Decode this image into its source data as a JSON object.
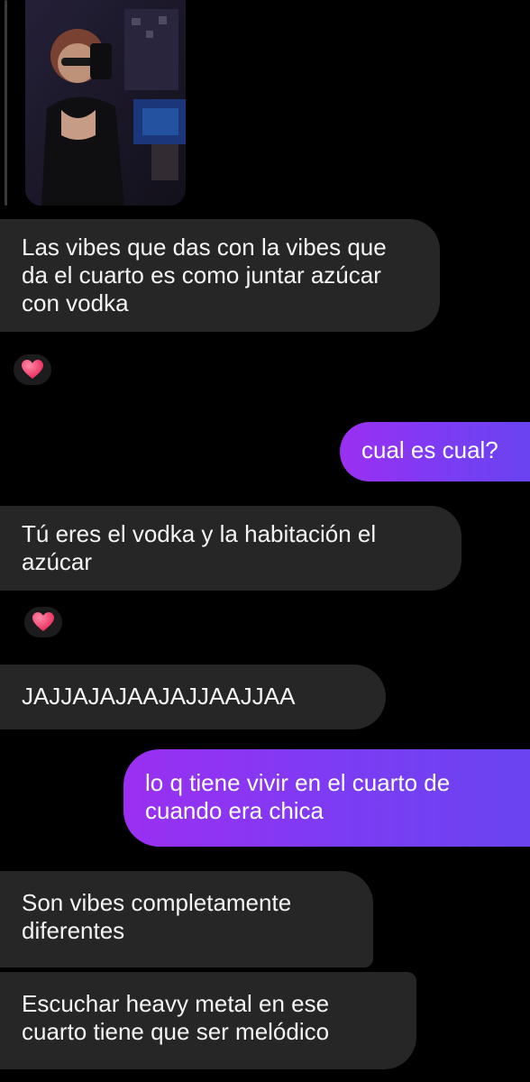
{
  "thread": {
    "shared_photo": {
      "kind": "mirror-selfie",
      "accent_colors": [
        "#3b2f6b",
        "#1e2a5a",
        "#b56a4a"
      ]
    },
    "messages": [
      {
        "id": "m1",
        "direction": "incoming",
        "text": "Las vibes que das con la vibes que da el cuarto es como juntar azúcar con vodka",
        "reaction": "heart-emoji"
      },
      {
        "id": "m2",
        "direction": "outgoing",
        "text": "cual es cual?"
      },
      {
        "id": "m3",
        "direction": "incoming",
        "text": "Tú eres el vodka y la habitación el azúcar",
        "reaction": "heart-emoji"
      },
      {
        "id": "m4",
        "direction": "incoming",
        "text": "JAJJAJAJAAJAJJAAJJAA"
      },
      {
        "id": "m5",
        "direction": "outgoing",
        "text": "lo q tiene vivir en el cuarto de cuando era chica"
      },
      {
        "id": "m6",
        "direction": "incoming",
        "text": "Son vibes completamente diferentes"
      },
      {
        "id": "m7",
        "direction": "incoming",
        "text": "Escuchar heavy metal en ese cuarto tiene que ser melódico"
      }
    ]
  },
  "colors": {
    "background": "#000000",
    "incoming_bubble": "#262626",
    "outgoing_gradient_start": "#9b2ff2",
    "outgoing_gradient_end": "#6a44f0",
    "heart": "#ff3b6b"
  }
}
